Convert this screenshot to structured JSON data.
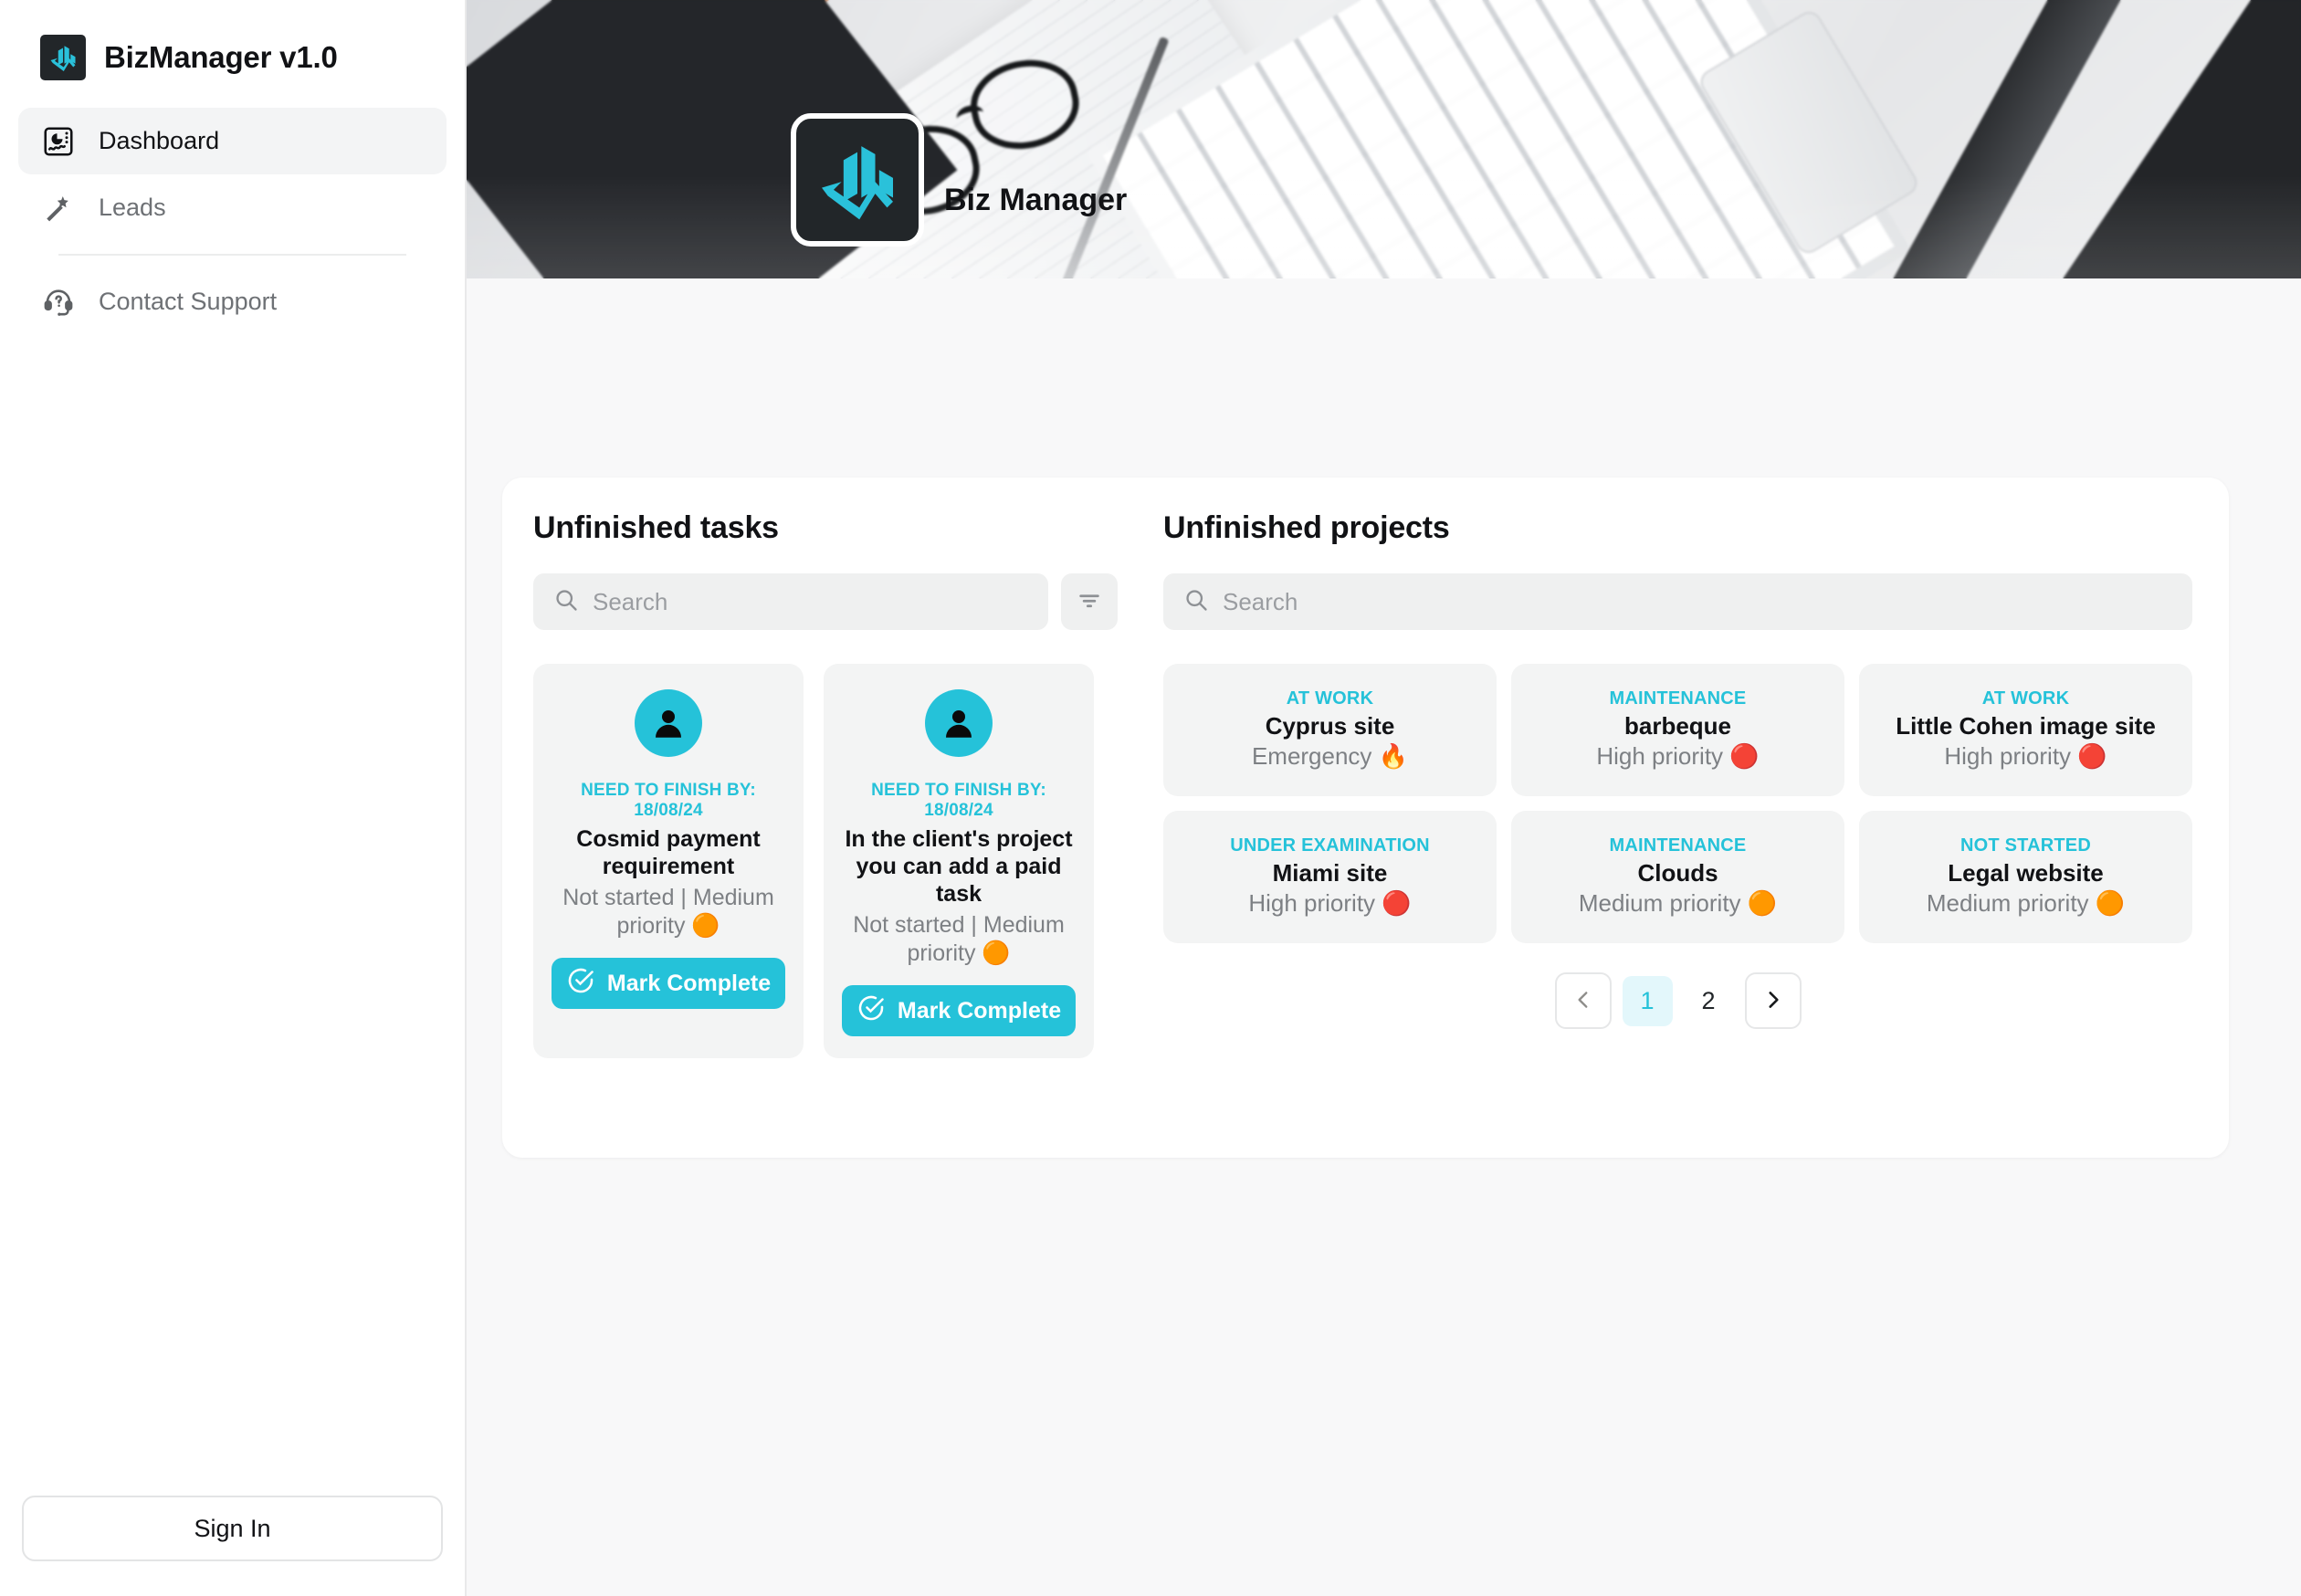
{
  "sidebar": {
    "brand": {
      "title": "BizManager v1.0",
      "logo_icon": "biz-chart-logo-icon"
    },
    "items": [
      {
        "label": "Dashboard",
        "icon": "dashboard-chart-icon",
        "active": true
      },
      {
        "label": "Leads",
        "icon": "magic-wand-icon",
        "active": false
      },
      {
        "label": "Contact Support",
        "icon": "headset-question-icon",
        "active": false
      }
    ],
    "sign_in_label": "Sign In"
  },
  "header": {
    "app_title": "Biz Manager",
    "logo_icon": "biz-chart-logo-icon",
    "banner_alt": "desk-photo-keyboard-glasses-notebook"
  },
  "tasks_panel": {
    "title": "Unfinished tasks",
    "search": {
      "placeholder": "Search",
      "value": "",
      "icon": "search-icon"
    },
    "filter_icon": "filter-icon",
    "cards": [
      {
        "avatar_icon": "user-avatar-icon",
        "due": "NEED TO FINISH BY: 18/08/24",
        "name": "Cosmid payment requirement",
        "meta": "Not started | Medium priority",
        "priority_emoji": "🟠",
        "button": {
          "label": "Mark Complete",
          "icon": "check-circle-icon"
        }
      },
      {
        "avatar_icon": "user-avatar-icon",
        "due": "NEED TO FINISH BY: 18/08/24",
        "name": "In the client's project you can add a paid task",
        "meta": "Not started | Medium priority",
        "priority_emoji": "🟠",
        "button": {
          "label": "Mark Complete",
          "icon": "check-circle-icon"
        }
      }
    ]
  },
  "projects_panel": {
    "title": "Unfinished projects",
    "search": {
      "placeholder": "Search",
      "value": "",
      "icon": "search-icon"
    },
    "cards": [
      {
        "status": "AT WORK",
        "name": "Cyprus site",
        "priority": "Emergency",
        "emoji": "🔥"
      },
      {
        "status": "MAINTENANCE",
        "name": "barbeque",
        "priority": "High priority",
        "emoji": "🔴"
      },
      {
        "status": "AT WORK",
        "name": "Little Cohen image site",
        "priority": "High priority",
        "emoji": "🔴"
      },
      {
        "status": "UNDER EXAMINATION",
        "name": "Miami site",
        "priority": "High priority",
        "emoji": "🔴"
      },
      {
        "status": "MAINTENANCE",
        "name": "Clouds",
        "priority": "Medium priority",
        "emoji": "🟠"
      },
      {
        "status": "NOT STARTED",
        "name": "Legal website",
        "priority": "Medium priority",
        "emoji": "🟠"
      }
    ],
    "pagination": {
      "prev_icon": "chevron-left-icon",
      "next_icon": "chevron-right-icon",
      "pages": [
        "1",
        "2"
      ],
      "current": "1"
    }
  },
  "colors": {
    "accent": "#25c2d9",
    "accent_soft": "#e3f7fb",
    "dark": "#222629",
    "muted_text": "#7d8084",
    "card_bg": "#f3f4f4",
    "page_bg": "#f8f8f9"
  }
}
